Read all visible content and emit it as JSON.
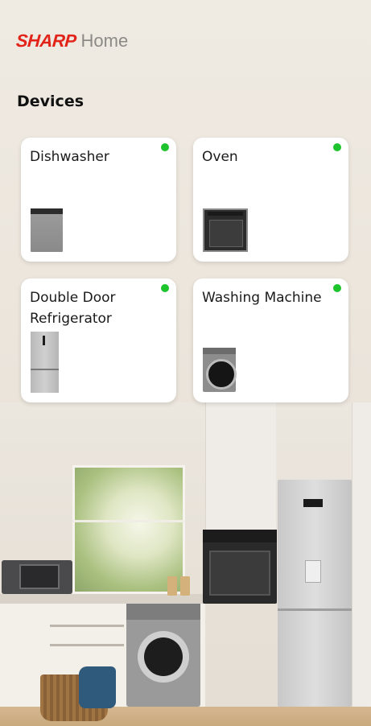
{
  "brand": {
    "logo_text": "SHARP",
    "app_name": "Home",
    "logo_color": "#e2231a"
  },
  "section_title": "Devices",
  "status_color_online": "#1ec42d",
  "devices": [
    {
      "label": "Dishwasher",
      "status": "online",
      "icon": "dishwasher-icon"
    },
    {
      "label": "Oven",
      "status": "online",
      "icon": "oven-icon"
    },
    {
      "label": "Double Door Refrigerator",
      "status": "online",
      "icon": "refrigerator-icon"
    },
    {
      "label": "Washing Machine",
      "status": "online",
      "icon": "washing-machine-icon"
    }
  ]
}
